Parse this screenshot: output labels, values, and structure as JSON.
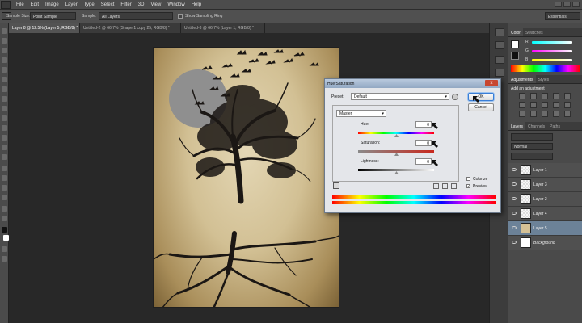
{
  "menu": [
    "File",
    "Edit",
    "Image",
    "Layer",
    "Type",
    "Select",
    "Filter",
    "3D",
    "View",
    "Window",
    "Help"
  ],
  "options_bar": {
    "sample_size_label": "Sample Size:",
    "sample_size_value": "Point Sample",
    "sample_label": "Sample:",
    "sample_value": "All Layers",
    "show_ring_label": "Show Sampling Ring",
    "workspace": "Essentials"
  },
  "tabs": [
    "Layer 8 @ 12.5% (Layer 5, RGB/8) *",
    "Untitled-2 @ 66.7% (Shape 1 copy 25, RGB/8) *",
    "Untitled-3 @ 66.7% (Layer 1, RGB/8) *"
  ],
  "panels": {
    "color_tabs": [
      "Color",
      "Swatches"
    ],
    "color_channels": [
      "R",
      "G",
      "B"
    ],
    "adj_tabs": [
      "Adjustments",
      "Styles"
    ],
    "adj_title": "Add an adjustment",
    "layers_tabs": [
      "Layers",
      "Channels",
      "Paths"
    ],
    "blend_mode": "Normal",
    "layers": [
      {
        "name": "Layer 1",
        "selected": false,
        "thumb": "checker"
      },
      {
        "name": "Layer 3",
        "selected": false,
        "thumb": "checker"
      },
      {
        "name": "Layer 2",
        "selected": false,
        "thumb": "checker"
      },
      {
        "name": "Layer 4",
        "selected": false,
        "thumb": "checker"
      },
      {
        "name": "Layer 5",
        "selected": true,
        "thumb": "paper"
      },
      {
        "name": "Background",
        "selected": false,
        "thumb": "white"
      }
    ]
  },
  "dialog": {
    "title": "Hue/Saturation",
    "close": "x",
    "preset_label": "Preset:",
    "preset_value": "Default",
    "channel_value": "Master",
    "hue_label": "Hue:",
    "hue_value": "0",
    "saturation_label": "Saturation:",
    "saturation_value": "0",
    "lightness_label": "Lightness:",
    "lightness_value": "0",
    "ok": "OK",
    "cancel": "Cancel",
    "colorize_label": "Colorize",
    "colorize_checked": false,
    "preview_label": "Preview",
    "preview_checked": true,
    "check_mark": "✓"
  },
  "colors": {
    "app_bg": "#282828",
    "panel": "#4a4a4a",
    "selected_layer": "#6c8298",
    "dialog_bg": "#e4e6ea",
    "moon": "#8f8f8f",
    "ink": "#1b1714"
  }
}
